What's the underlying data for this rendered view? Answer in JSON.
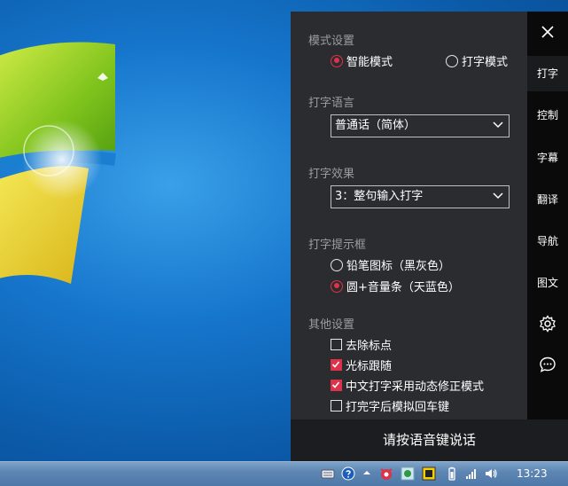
{
  "sections": {
    "mode": {
      "title": "模式设置",
      "options": [
        "智能模式",
        "打字模式"
      ],
      "selected": 0
    },
    "language": {
      "title": "打字语言",
      "value": "普通话（简体）"
    },
    "effect": {
      "title": "打字效果",
      "value": "3：整句输入打字"
    },
    "indicator": {
      "title": "打字提示框",
      "options": [
        "铅笔图标（黑灰色）",
        "圆+音量条（天蓝色）"
      ],
      "selected": 1
    },
    "other": {
      "title": "其他设置",
      "checks": [
        {
          "label": "去除标点",
          "checked": false
        },
        {
          "label": "光标跟随",
          "checked": true
        },
        {
          "label": "中文打字采用动态修正模式",
          "checked": true
        },
        {
          "label": "打完字后模拟回车键",
          "checked": false
        }
      ]
    }
  },
  "sidebar": {
    "items": [
      "打字",
      "控制",
      "字幕",
      "翻译",
      "导航",
      "图文"
    ],
    "active": 0
  },
  "footer": {
    "label": "请按语音键说话"
  },
  "taskbar": {
    "clock": "13:23"
  },
  "colors": {
    "accent": "#e0314a",
    "panel_bg": "#2a2c30",
    "sidebar_bg": "#0a0a0b"
  },
  "icons": [
    "close-icon",
    "settings-gear-icon",
    "chat-bubble-icon",
    "keyboard-icon",
    "help-icon",
    "chevron-up-icon",
    "tray-app-icon",
    "network-icon",
    "volume-icon",
    "battery-icon"
  ]
}
